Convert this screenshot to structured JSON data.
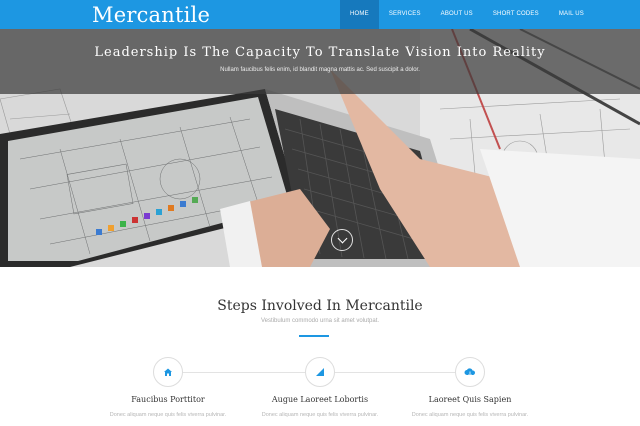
{
  "header": {
    "logo": "Mercantile",
    "nav": [
      {
        "label": "HOME",
        "active": true
      },
      {
        "label": "SERVICES",
        "active": false
      },
      {
        "label": "ABOUT US",
        "active": false
      },
      {
        "label": "SHORT CODES",
        "active": false
      },
      {
        "label": "MAIL US",
        "active": false
      }
    ]
  },
  "hero": {
    "title": "Leadership Is The Capacity To Translate Vision Into Reality",
    "subtitle": "Nullam faucibus felis enim, id blandit magna mattis ac. Sed suscipit a dolor.",
    "scroll_icon": "chevron-down-icon"
  },
  "steps_section": {
    "title": "Steps Involved In Mercantile",
    "subtitle": "Vestibulum commodo urna sit amet volutpat.",
    "steps": [
      {
        "title": "Faucibus Porttitor",
        "text": "Donec aliquam neque quis felis viverra pulvinar.",
        "icon": "home-icon"
      },
      {
        "title": "Augue Laoreet Lobortis",
        "text": "Donec aliquam neque quis felis viverra pulvinar.",
        "icon": "signal-icon"
      },
      {
        "title": "Laoreet Quis Sapien",
        "text": "Donec aliquam neque quis felis viverra pulvinar.",
        "icon": "cloud-icon"
      }
    ]
  },
  "colors": {
    "accent": "#1d97e2",
    "nav_active": "#1679bd",
    "hero_band": "#3a3a3a"
  }
}
